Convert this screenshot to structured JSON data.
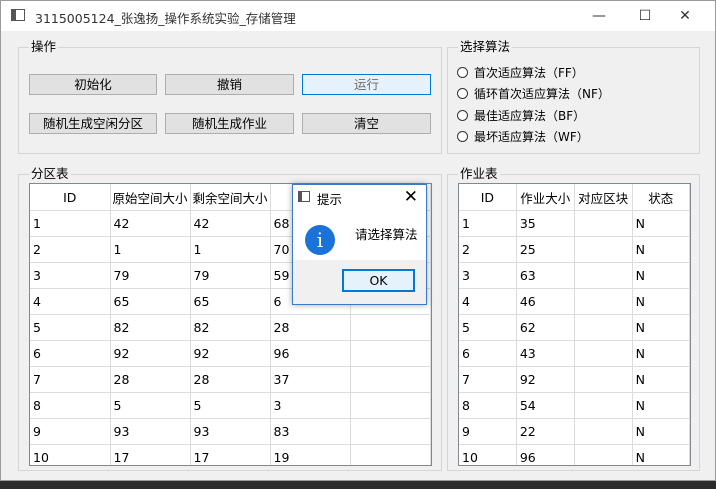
{
  "window": {
    "title": "3115005124_张逸扬_操作系统实验_存储管理",
    "minimize_glyph": "—",
    "maximize_glyph": "☐",
    "close_glyph": "✕"
  },
  "operations": {
    "title": "操作",
    "buttons": {
      "init": "初始化",
      "undo": "撤销",
      "run": "运行",
      "random_partitions": "随机生成空闲分区",
      "random_jobs": "随机生成作业",
      "clear": "清空"
    }
  },
  "algorithm": {
    "title": "选择算法",
    "options": [
      "首次适应算法（FF）",
      "循环首次适应算法（NF）",
      "最佳适应算法（BF）",
      "最坏适应算法（WF）"
    ]
  },
  "partition_table": {
    "title": "分区表",
    "headers": [
      "ID",
      "原始空间大小",
      "剩余空间大小",
      "",
      ""
    ],
    "rows": [
      [
        "1",
        "42",
        "42",
        "68",
        ""
      ],
      [
        "2",
        "1",
        "1",
        "70",
        ""
      ],
      [
        "3",
        "79",
        "79",
        "59",
        ""
      ],
      [
        "4",
        "65",
        "65",
        "6",
        ""
      ],
      [
        "5",
        "82",
        "82",
        "28",
        ""
      ],
      [
        "6",
        "92",
        "92",
        "96",
        ""
      ],
      [
        "7",
        "28",
        "28",
        "37",
        ""
      ],
      [
        "8",
        "5",
        "5",
        "3",
        ""
      ],
      [
        "9",
        "93",
        "93",
        "83",
        ""
      ],
      [
        "10",
        "17",
        "17",
        "19",
        ""
      ]
    ]
  },
  "job_table": {
    "title": "作业表",
    "headers": [
      "ID",
      "作业大小",
      "对应区块",
      "状态"
    ],
    "rows": [
      [
        "1",
        "35",
        "",
        "N"
      ],
      [
        "2",
        "25",
        "",
        "N"
      ],
      [
        "3",
        "63",
        "",
        "N"
      ],
      [
        "4",
        "46",
        "",
        "N"
      ],
      [
        "5",
        "62",
        "",
        "N"
      ],
      [
        "6",
        "43",
        "",
        "N"
      ],
      [
        "7",
        "92",
        "",
        "N"
      ],
      [
        "8",
        "54",
        "",
        "N"
      ],
      [
        "9",
        "22",
        "",
        "N"
      ],
      [
        "10",
        "96",
        "",
        "N"
      ]
    ]
  },
  "dialog": {
    "title": "提示",
    "message": "请选择算法",
    "icon": "info-icon",
    "icon_glyph": "i",
    "close_glyph": "✕",
    "ok_label": "OK"
  },
  "colors": {
    "focus_border": "#0078d7",
    "info_icon": "#1a73d9"
  }
}
